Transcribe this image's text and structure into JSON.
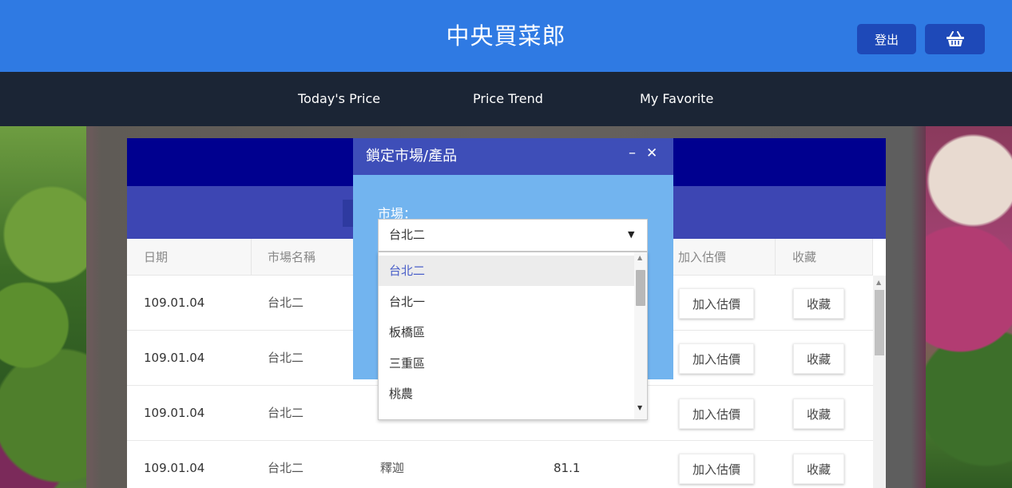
{
  "header": {
    "title": "中央買菜郎",
    "logout_label": "登出",
    "cart_icon": "basket-icon"
  },
  "nav": {
    "items": [
      {
        "label": "Today's Price"
      },
      {
        "label": "Price Trend"
      },
      {
        "label": "My Favorite"
      }
    ]
  },
  "table": {
    "headers": {
      "date": "日期",
      "market": "市場名稱",
      "add_estimate": "加入估價",
      "favorite": "收藏"
    },
    "rows": [
      {
        "date": "109.01.04",
        "market": "台北二",
        "product": "",
        "price": "",
        "add_estimate": "加入估價",
        "favorite": "收藏"
      },
      {
        "date": "109.01.04",
        "market": "台北二",
        "product": "",
        "price": "",
        "add_estimate": "加入估價",
        "favorite": "收藏"
      },
      {
        "date": "109.01.04",
        "market": "台北二",
        "product": "",
        "price": "",
        "add_estimate": "加入估價",
        "favorite": "收藏"
      },
      {
        "date": "109.01.04",
        "market": "台北二",
        "product": "釋迦",
        "price": "81.1",
        "add_estimate": "加入估價",
        "favorite": "收藏"
      }
    ]
  },
  "modal": {
    "title": "鎖定市場/產品",
    "minimize_symbol": "–",
    "close_symbol": "✕",
    "market_label": "市場：",
    "selected_market": "台北二",
    "options": [
      "台北二",
      "台北一",
      "板橋區",
      "三重區",
      "桃農"
    ]
  },
  "colors": {
    "header_bg": "#2f7ae3",
    "nav_bg": "#1b2535",
    "panel_head": "#00008f",
    "panel_sub": "#3d46b3",
    "modal_head": "#3e4eb8",
    "modal_body": "#72b4ef"
  }
}
